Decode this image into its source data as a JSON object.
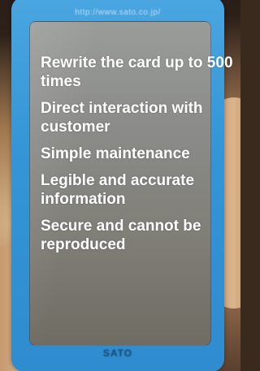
{
  "card": {
    "url": "http://www.sato.co.jp/",
    "brand": "SATO",
    "colors": {
      "card_blue": "#3595d6",
      "panel_gray": "#8c8d8a",
      "text": "#ffffff"
    }
  },
  "features": [
    "Rewrite the card up to 500 times",
    "Direct interaction with customer",
    "Simple maintenance",
    "Legible and accurate information",
    "Secure and cannot be reproduced"
  ]
}
